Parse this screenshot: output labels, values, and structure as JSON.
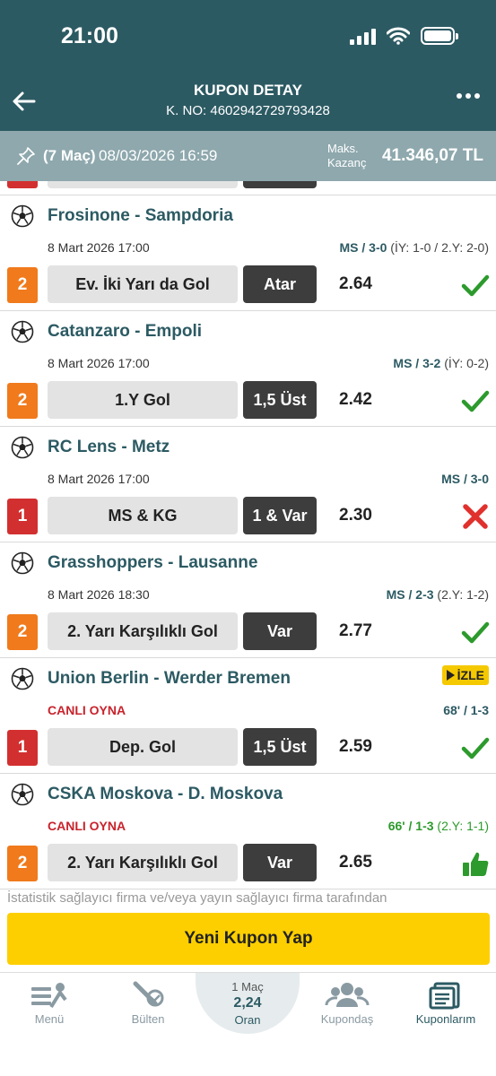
{
  "status_bar": {
    "time": "21:00"
  },
  "header": {
    "title": "KUPON DETAY",
    "coupon_no": "K. NO: 4602942729793428"
  },
  "info": {
    "match_count": "(7 Maç)",
    "date": "08/03/2026 16:59",
    "max_win_label_1": "Maks.",
    "max_win_label_2": "Kazanç",
    "max_win_amount": "41.346,07 TL"
  },
  "colors": {
    "header": "#2c5a63",
    "info_bar": "#8ea8ad",
    "bet_number_orange": "#f07a1c",
    "bet_number_red": "#d23030",
    "win_green": "#2c9a2c",
    "loss_red": "#e0312d",
    "button_yellow": "#fdcf00"
  },
  "matches": [
    {
      "teams": "Frosinone - Sampdoria",
      "date": "8 Mart 2026 17:00",
      "result_main": "MS / 3-0",
      "result_extra": " (İY: 1-0 / 2.Y: 2-0)",
      "number": "2",
      "market": "Ev. İki Yarı da Gol",
      "selection": "Atar",
      "odd": "2.64",
      "status": "won"
    },
    {
      "teams": "Catanzaro - Empoli",
      "date": "8 Mart 2026 17:00",
      "result_main": "MS / 3-2",
      "result_extra": " (İY: 0-2)",
      "number": "2",
      "market": "1.Y Gol",
      "selection": "1,5 Üst",
      "odd": "2.42",
      "status": "won"
    },
    {
      "teams": "RC Lens - Metz",
      "date": "8 Mart 2026 17:00",
      "result_main": "MS / 3-0",
      "result_extra": "",
      "number": "1",
      "market": "MS & KG",
      "selection": "1 & Var",
      "odd": "2.30",
      "status": "lost"
    },
    {
      "teams": "Grasshoppers - Lausanne",
      "date": "8 Mart 2026 18:30",
      "result_main": "MS / 2-3",
      "result_extra": " (2.Y: 1-2)",
      "number": "2",
      "market": "2. Yarı Karşılıklı Gol",
      "selection": "Var",
      "odd": "2.77",
      "status": "won"
    },
    {
      "teams": "Union Berlin - Werder Bremen",
      "live_label": "CANLI OYNA",
      "watch_label": "İZLE",
      "result_main": "68' / 1-3",
      "result_extra": "",
      "number": "1",
      "market": "Dep. Gol",
      "selection": "1,5 Üst",
      "odd": "2.59",
      "status": "won"
    },
    {
      "teams": "CSKA Moskova - D. Moskova",
      "live_label": "CANLI OYNA",
      "result_main": "66' / 1-3",
      "result_extra": " (2.Y: 1-1)",
      "number": "2",
      "market": "2. Yarı Karşılıklı Gol",
      "selection": "Var",
      "odd": "2.65",
      "status": "live-winning"
    }
  ],
  "disclaimer": "İstatistik sağlayıcı firma ve/veya yayın sağlayıcı firma tarafından",
  "new_coupon_label": "Yeni Kupon Yap",
  "tabbar": {
    "menu": "Menü",
    "bulletin": "Bülten",
    "center_line1": "1 Maç",
    "center_line2": "2,24",
    "center_line3": "Oran",
    "kupondas": "Kupondaş",
    "kuponlarim": "Kuponlarım"
  }
}
